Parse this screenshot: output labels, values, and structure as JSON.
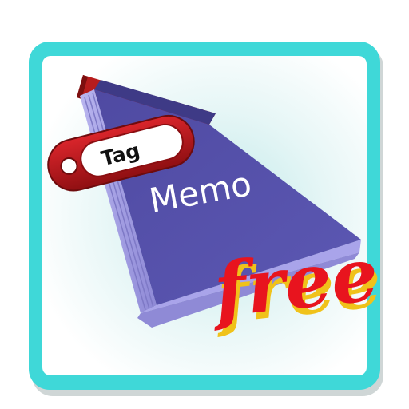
{
  "icon": {
    "tag_label": "Tag",
    "memo_label": "Memo",
    "free_label": "free",
    "colors": {
      "frame": "#3fd8d8",
      "frame_shadow": "#c9d2d2",
      "panel_glow": "#bfe9e9",
      "book_cover": "#5a56ae",
      "book_cover_dark": "#4a4596",
      "book_pages": "#9e99e2",
      "book_spine_red": "#b71c1c",
      "tag_red": "#c4161c",
      "tag_dark": "#7e0d10",
      "free_red": "#e8141e",
      "free_shadow": "#f0c21a"
    }
  }
}
